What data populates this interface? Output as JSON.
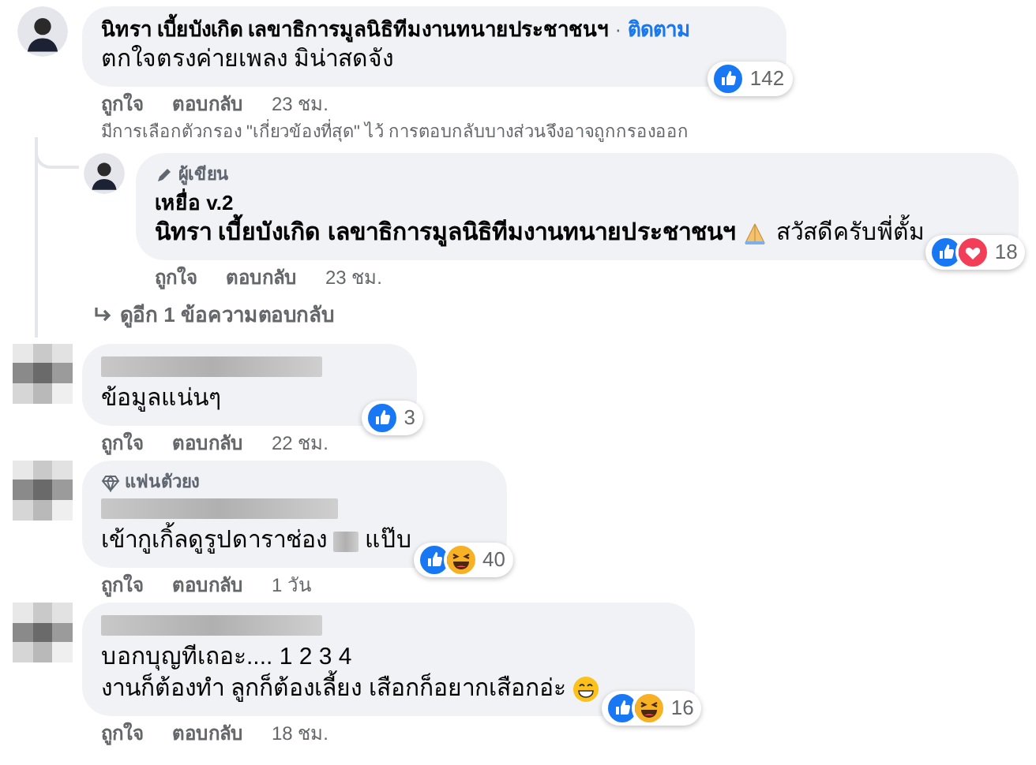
{
  "comments": [
    {
      "avatar": {
        "kind": "photo"
      },
      "author": "นิทรา เบี้ยบังเกิด เลขาธิการมูลนิธิทีมงานทนายประชาชนฯ",
      "separator": "·",
      "follow": "ติดตาม",
      "lines": [
        [
          {
            "kind": "text",
            "text": "ตกใจตรงค่ายเพลง มิน่าสดจัง"
          }
        ]
      ],
      "reactions": {
        "types": [
          {
            "kind": "like"
          }
        ],
        "count": "142"
      },
      "actions": {
        "like": "ถูกใจ",
        "reply": "ตอบกลับ",
        "time": "23 ชม."
      },
      "filter_note": "มีการเลือกตัวกรอง \"เกี่ยวข้องที่สุด\" ไว้ การตอบกลับบางส่วนจึงอาจถูกกรองออก",
      "replies": [
        {
          "avatar": {
            "kind": "photo"
          },
          "badge": {
            "kind": "author",
            "label": "ผู้เขียน"
          },
          "author": "เหยื่อ v.2",
          "lines": [
            [
              {
                "kind": "mention",
                "text": "นิทรา เบี้ยบังเกิด เลขาธิการมูลนิธิทีมงานทนายประชาชนฯ"
              },
              {
                "kind": "pray-emoji"
              },
              {
                "kind": "text",
                "text": "สวัสดีครับพี่ตั้ม"
              }
            ]
          ],
          "reactions": {
            "types": [
              {
                "kind": "like"
              },
              {
                "kind": "love"
              }
            ],
            "count": "18"
          },
          "actions": {
            "like": "ถูกใจ",
            "reply": "ตอบกลับ",
            "time": "23 ชม."
          }
        }
      ],
      "more_replies": "ดูอีก 1 ข้อความตอบกลับ"
    },
    {
      "avatar": {
        "kind": "blurred"
      },
      "author_blurred": true,
      "lines": [
        [
          {
            "kind": "text",
            "text": "ข้อมูลแน่นๆ"
          }
        ]
      ],
      "reactions": {
        "types": [
          {
            "kind": "like"
          }
        ],
        "count": "3"
      },
      "actions": {
        "like": "ถูกใจ",
        "reply": "ตอบกลับ",
        "time": "22 ชม."
      }
    },
    {
      "avatar": {
        "kind": "blurred"
      },
      "badge": {
        "kind": "fan",
        "label": "แฟนตัวยง"
      },
      "author_blurred": true,
      "lines": [
        [
          {
            "kind": "text",
            "text": "เข้ากูเกิ้ลดูรูปดาราช่อง"
          },
          {
            "kind": "blur"
          },
          {
            "kind": "text",
            "text": "แป๊บ"
          }
        ]
      ],
      "reactions": {
        "types": [
          {
            "kind": "like"
          },
          {
            "kind": "haha"
          }
        ],
        "count": "40"
      },
      "actions": {
        "like": "ถูกใจ",
        "reply": "ตอบกลับ",
        "time": "1 วัน"
      }
    },
    {
      "avatar": {
        "kind": "blurred"
      },
      "author_blurred": true,
      "lines": [
        [
          {
            "kind": "text",
            "text": "บอกบุญทีเถอะ.... 1 2 3 4"
          }
        ],
        [
          {
            "kind": "text",
            "text": "งานก็ต้องทำ ลูกก็ต้องเลี้ยง เสือกก็อยากเสือกอ่ะ"
          },
          {
            "kind": "smile-emoji"
          }
        ]
      ],
      "reactions": {
        "types": [
          {
            "kind": "like"
          },
          {
            "kind": "haha"
          }
        ],
        "count": "16"
      },
      "actions": {
        "like": "ถูกใจ",
        "reply": "ตอบกลับ",
        "time": "18 ชม."
      }
    }
  ]
}
